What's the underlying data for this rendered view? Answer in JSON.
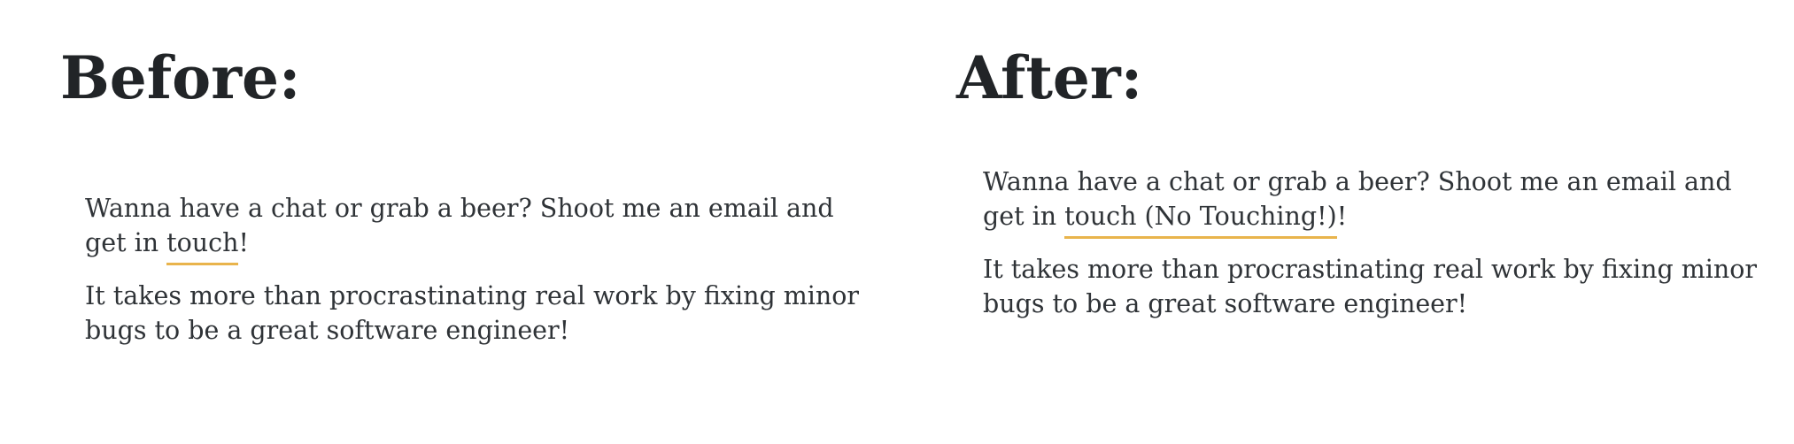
{
  "before": {
    "heading": "Before:",
    "paragraph1_text": "Wanna have a chat or grab a beer? Shoot me an email and get in ",
    "paragraph1_link": "touch",
    "paragraph1_end": "!",
    "paragraph2": "It takes more than procrastinating real work by fixing minor bugs to be a great software engineer!"
  },
  "after": {
    "heading": "After:",
    "paragraph1_text": "Wanna have a chat or grab a beer? Shoot me an email and get in ",
    "paragraph1_link": "touch (No Touching!)",
    "paragraph1_end": "!",
    "paragraph2": "It takes more than procrastinating real work by fixing minor bugs to be a great software engineer!"
  },
  "colors": {
    "link_underline": "#e9b44c",
    "heading_text": "#212427",
    "body_text": "#2f3337"
  }
}
